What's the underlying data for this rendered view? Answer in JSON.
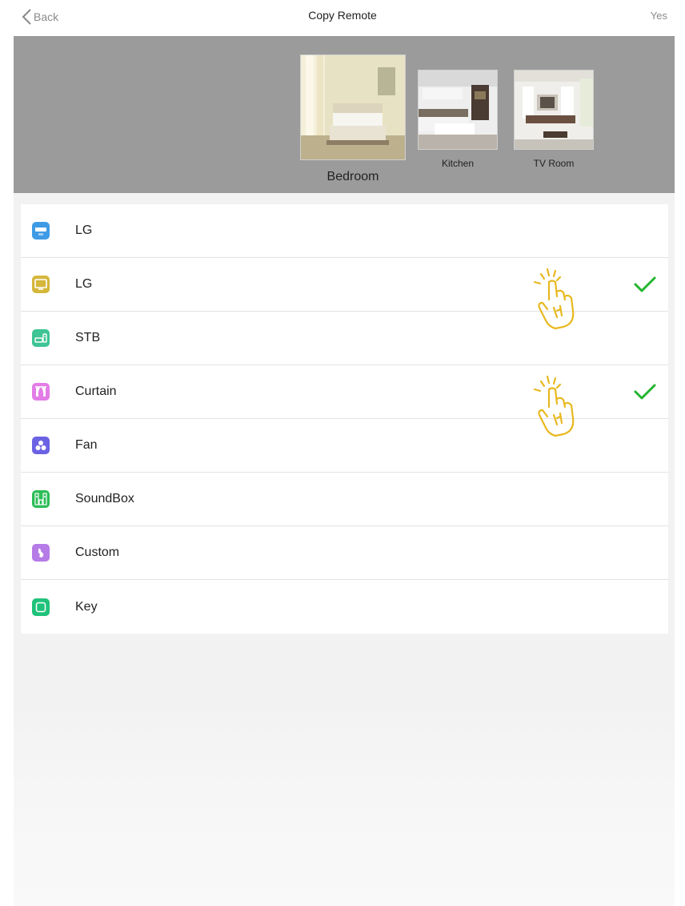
{
  "nav": {
    "back_label": "Back",
    "title": "Copy Remote",
    "confirm_label": "Yes"
  },
  "rooms": {
    "selected": "Bedroom",
    "items": [
      {
        "label": "Bedroom"
      },
      {
        "label": "Kitchen"
      },
      {
        "label": "TV Room"
      }
    ]
  },
  "devices": [
    {
      "label": "LG",
      "icon": "air-conditioner-icon",
      "color": "#3f9be6",
      "checked": false
    },
    {
      "label": "LG",
      "icon": "tv-icon",
      "color": "#d4b73b",
      "checked": true
    },
    {
      "label": "STB",
      "icon": "set-top-box-icon",
      "color": "#3ec495",
      "checked": false
    },
    {
      "label": "Curtain",
      "icon": "curtain-icon",
      "color": "#e37ce6",
      "checked": true
    },
    {
      "label": "Fan",
      "icon": "fan-icon",
      "color": "#6b62e3",
      "checked": false
    },
    {
      "label": "SoundBox",
      "icon": "speaker-icon",
      "color": "#2cbd57",
      "checked": false
    },
    {
      "label": "Custom",
      "icon": "custom-icon",
      "color": "#b57be6",
      "checked": false
    },
    {
      "label": "Key",
      "icon": "key-icon",
      "color": "#20c27a",
      "checked": false
    }
  ],
  "colors": {
    "check": "#22b52e",
    "tap_hint": "#e8b820",
    "room_strip_bg": "#9b9b9b"
  }
}
